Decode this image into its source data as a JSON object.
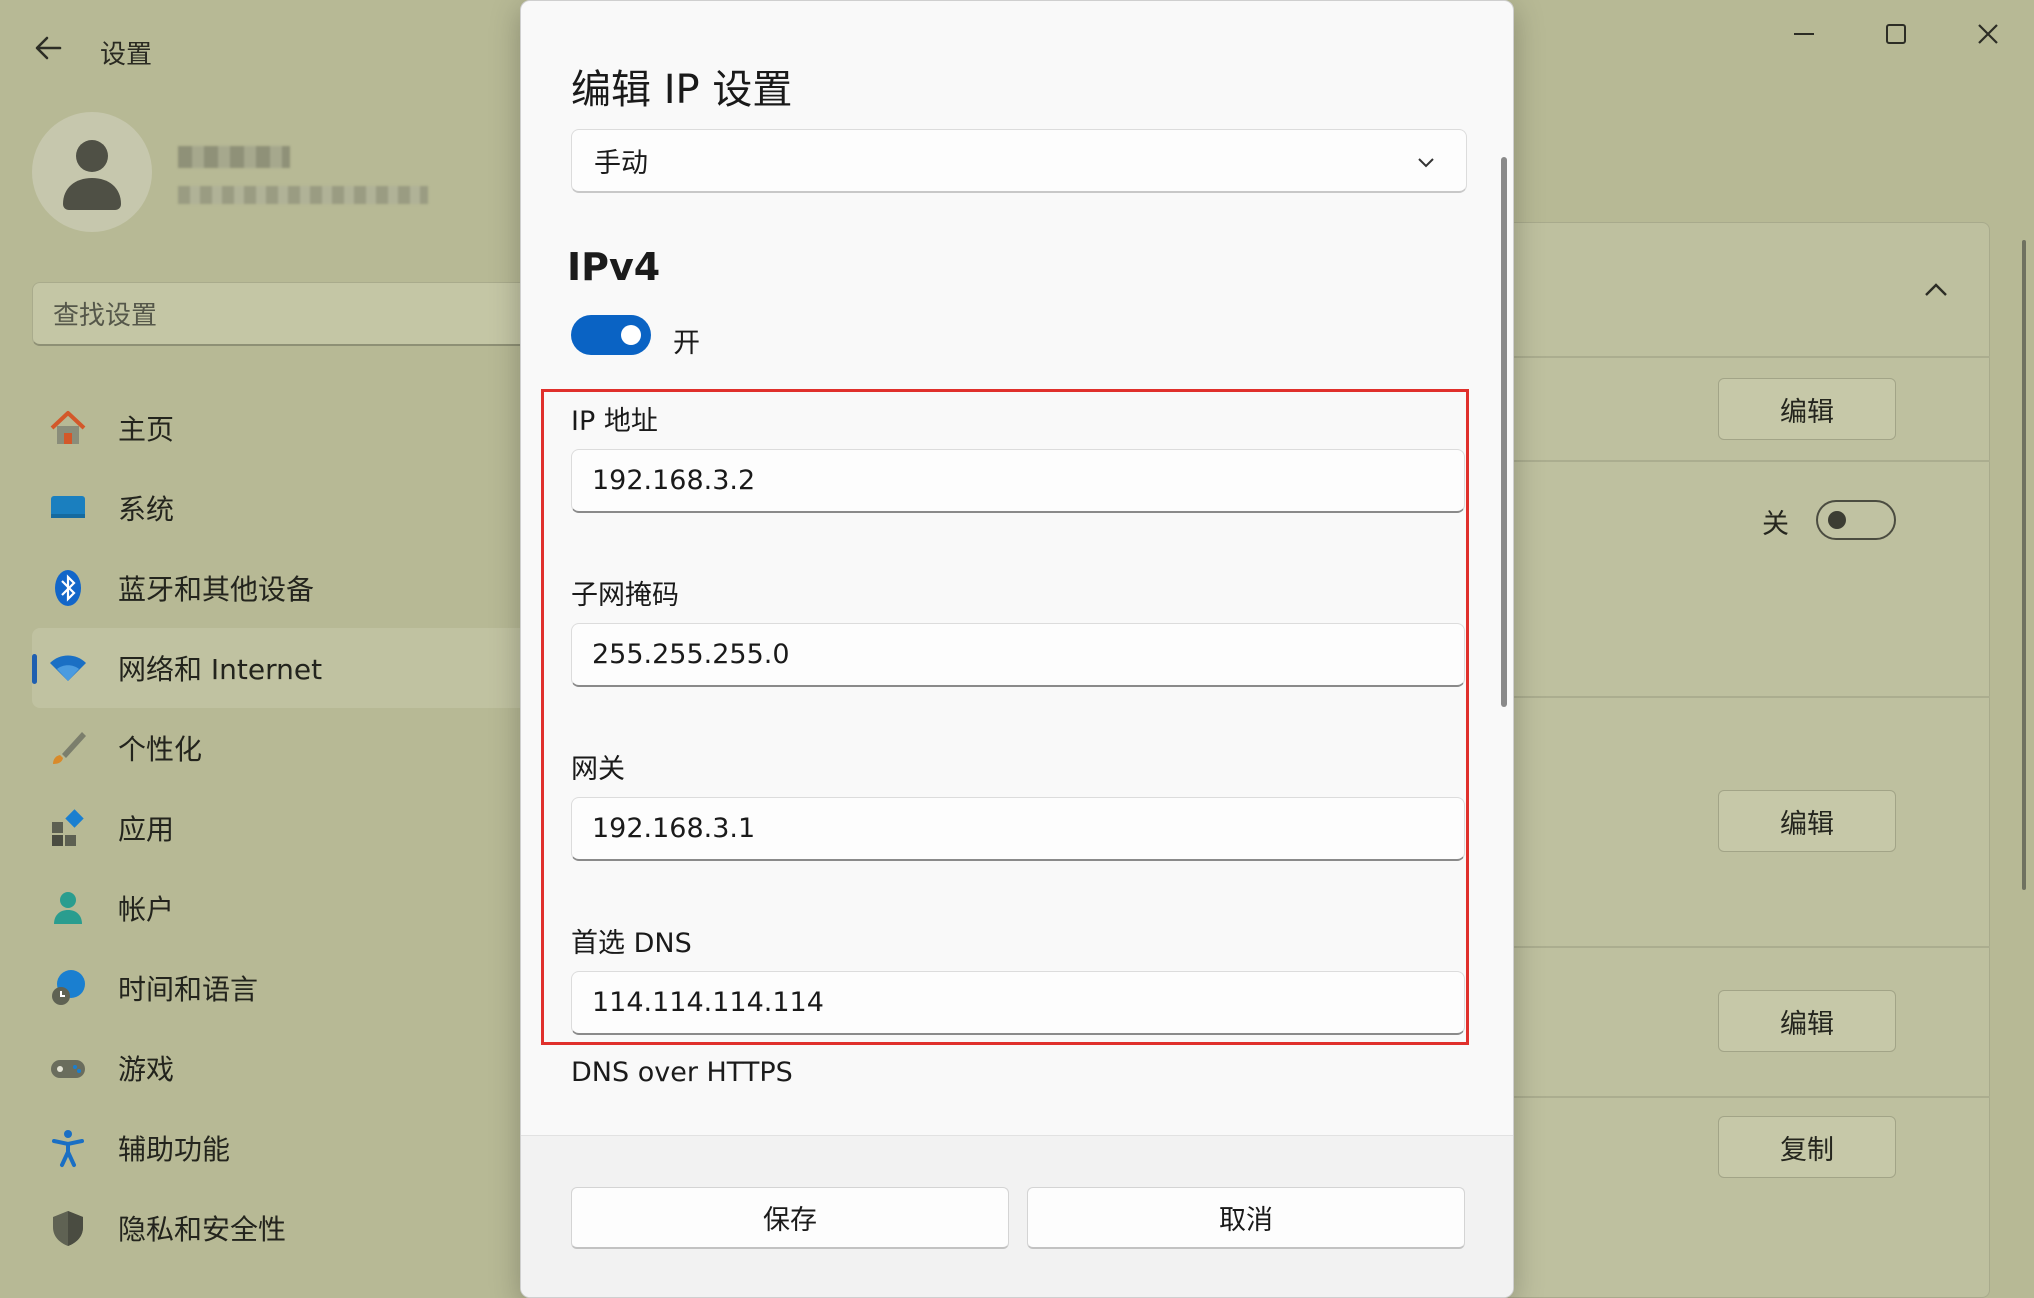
{
  "window": {
    "title": "设置",
    "controls": [
      "minimize-icon",
      "maximize-icon",
      "close-icon"
    ]
  },
  "search": {
    "placeholder": "查找设置"
  },
  "sidebar": {
    "items": [
      {
        "label": "主页",
        "icon": "home-icon"
      },
      {
        "label": "系统",
        "icon": "system-icon"
      },
      {
        "label": "蓝牙和其他设备",
        "icon": "bluetooth-icon"
      },
      {
        "label": "网络和 Internet",
        "icon": "wifi-icon",
        "active": true
      },
      {
        "label": "个性化",
        "icon": "brush-icon"
      },
      {
        "label": "应用",
        "icon": "apps-icon"
      },
      {
        "label": "帐户",
        "icon": "account-icon"
      },
      {
        "label": "时间和语言",
        "icon": "globe-clock-icon"
      },
      {
        "label": "游戏",
        "icon": "gamepad-icon"
      },
      {
        "label": "辅助功能",
        "icon": "accessibility-icon"
      },
      {
        "label": "隐私和安全性",
        "icon": "shield-icon"
      }
    ]
  },
  "right_panel": {
    "edit1": "编辑",
    "toggle_label": "关",
    "edit2": "编辑",
    "edit3": "编辑",
    "copy": "复制"
  },
  "dialog": {
    "title": "编辑 IP 设置",
    "mode": "手动",
    "section": "IPv4",
    "ipv4_toggle_label": "开",
    "ipv4_enabled": true,
    "fields": {
      "ip_label": "IP 地址",
      "ip_value": "192.168.3.2",
      "mask_label": "子网掩码",
      "mask_value": "255.255.255.0",
      "gateway_label": "网关",
      "gateway_value": "192.168.3.1",
      "dns_label": "首选 DNS",
      "dns_value": "114.114.114.114"
    },
    "doh_label": "DNS over HTTPS",
    "save": "保存",
    "cancel": "取消"
  },
  "colors": {
    "accent": "#0a63c4",
    "highlight": "#e0302c"
  }
}
